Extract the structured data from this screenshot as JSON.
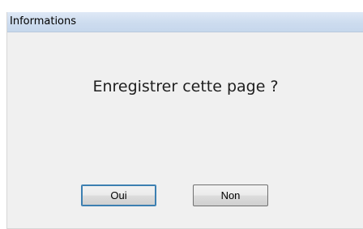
{
  "window": {
    "title": "Informations"
  },
  "dialog": {
    "message": "Enregistrer cette page ?",
    "buttons": {
      "yes_label": "Oui",
      "no_label": "Non"
    }
  },
  "colors": {
    "dialog_bg": "#f0f0f0",
    "titlebar_bg": "#cddcef",
    "message_text": "#1e1e1e"
  }
}
